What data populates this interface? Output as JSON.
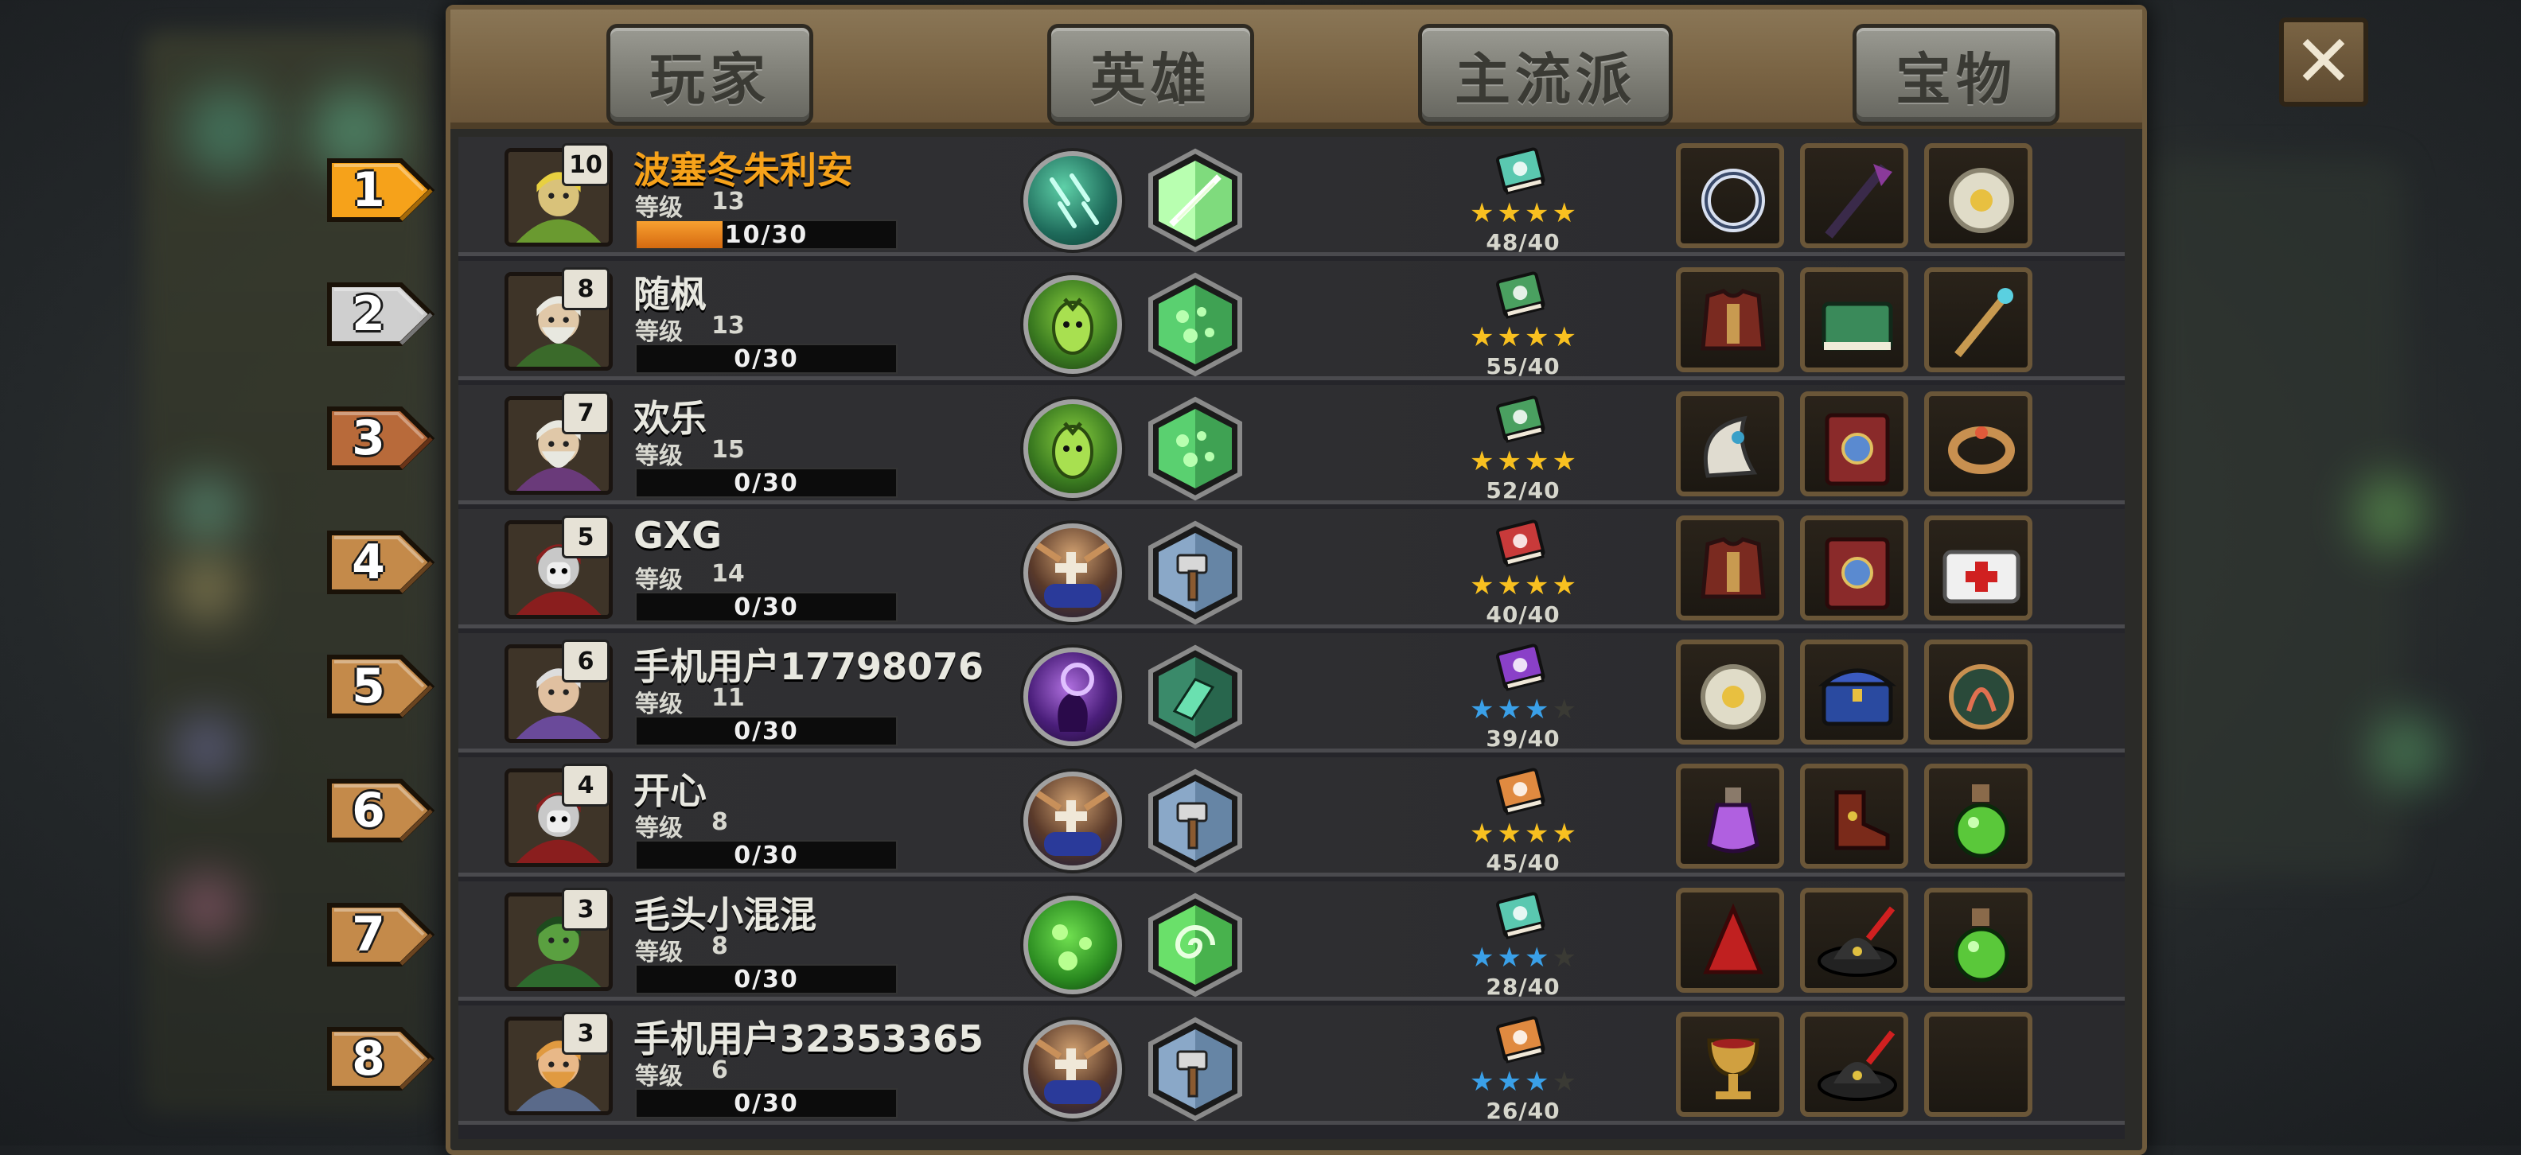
{
  "tabs": [
    "玩家",
    "英雄",
    "主流派",
    "宝物"
  ],
  "close_label": "✕",
  "level_label": "等级",
  "rows": [
    {
      "rank": "1",
      "hero_level": "10",
      "name": "波塞冬朱利安",
      "level": "13",
      "xp": "10/30",
      "xp_fraction": 0.33,
      "gold": true,
      "skill": "rain",
      "hex": "bright",
      "book": "teal",
      "stars": "gold",
      "star_count": 4,
      "ratio": "48/40",
      "items": [
        "ring-icon",
        "staff-icon",
        "amulet-icon"
      ],
      "avatar": "elf",
      "rank_style": "gold"
    },
    {
      "rank": "2",
      "hero_level": "8",
      "name": "随枫",
      "level": "13",
      "xp": "0/30",
      "xp_fraction": 0,
      "gold": false,
      "skill": "seed",
      "hex": "leaf",
      "book": "green",
      "stars": "gold",
      "star_count": 4,
      "ratio": "55/40",
      "items": [
        "armor-icon",
        "book-icon",
        "wand-icon"
      ],
      "avatar": "wizard",
      "rank_style": "silver"
    },
    {
      "rank": "3",
      "hero_level": "7",
      "name": "欢乐",
      "level": "15",
      "xp": "0/30",
      "xp_fraction": 0,
      "gold": false,
      "skill": "seed",
      "hex": "leaf",
      "book": "green",
      "stars": "gold",
      "star_count": 4,
      "ratio": "52/40",
      "items": [
        "horn-icon",
        "spellbook-icon",
        "bracelet-icon"
      ],
      "avatar": "mage",
      "rank_style": "bronze"
    },
    {
      "rank": "4",
      "hero_level": "5",
      "name": "GXG",
      "level": "14",
      "xp": "0/30",
      "xp_fraction": 0,
      "gold": false,
      "skill": "holy",
      "hex": "hammer",
      "book": "red",
      "stars": "gold",
      "star_count": 4,
      "ratio": "40/40",
      "items": [
        "armor-icon",
        "spellbook-icon",
        "medkit-icon"
      ],
      "avatar": "hood",
      "rank_style": "wood"
    },
    {
      "rank": "5",
      "hero_level": "6",
      "name": "手机用户17798076",
      "level": "11",
      "xp": "0/30",
      "xp_fraction": 0,
      "gold": false,
      "skill": "shadow",
      "hex": "shard",
      "book": "purple",
      "stars": "blue",
      "star_count": 3,
      "ratio": "39/40",
      "items": [
        "amulet-icon",
        "chest-icon",
        "rune-icon"
      ],
      "avatar": "monk",
      "rank_style": "wood"
    },
    {
      "rank": "6",
      "hero_level": "4",
      "name": "开心",
      "level": "8",
      "xp": "0/30",
      "xp_fraction": 0,
      "gold": false,
      "skill": "holy",
      "hex": "hammer",
      "book": "orange",
      "stars": "gold",
      "star_count": 4,
      "ratio": "45/40",
      "items": [
        "potion-purple-icon",
        "boots-icon",
        "potion-green-icon"
      ],
      "avatar": "hood",
      "rank_style": "wood"
    },
    {
      "rank": "7",
      "hero_level": "3",
      "name": "毛头小混混",
      "level": "8",
      "xp": "0/30",
      "xp_fraction": 0,
      "gold": false,
      "skill": "slime",
      "hex": "swirl",
      "book": "teal",
      "stars": "blue",
      "star_count": 3,
      "ratio": "28/40",
      "items": [
        "hood-icon",
        "hat-icon",
        "potion-green-icon"
      ],
      "avatar": "goblin",
      "rank_style": "wood"
    },
    {
      "rank": "8",
      "hero_level": "3",
      "name": "手机用户32353365",
      "level": "6",
      "xp": "0/30",
      "xp_fraction": 0,
      "gold": false,
      "skill": "holy",
      "hex": "hammer",
      "book": "orange",
      "stars": "blue",
      "star_count": 3,
      "ratio": "26/40",
      "items": [
        "goblet-icon",
        "hat-icon",
        "empty-slot"
      ],
      "avatar": "dwarf",
      "rank_style": "wood"
    }
  ],
  "colors": {
    "gold": "#f6a21a",
    "silver": "#cfcfcf",
    "bronze": "#b86a3a",
    "wood": "#c48a4a"
  }
}
